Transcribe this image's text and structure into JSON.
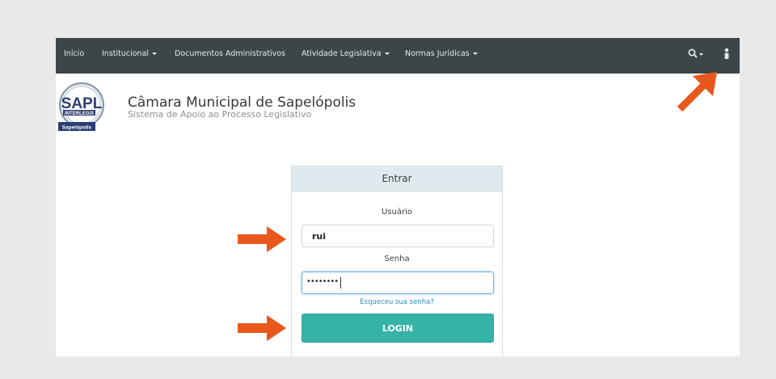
{
  "navbar": {
    "items": [
      {
        "label": "Início",
        "dropdown": false
      },
      {
        "label": "Institucional",
        "dropdown": true
      },
      {
        "label": "Documentos Administrativos",
        "dropdown": false
      },
      {
        "label": "Atividade Legislativa",
        "dropdown": true
      },
      {
        "label": "Normas Jurídicas",
        "dropdown": true
      }
    ],
    "icons": [
      "search-icon",
      "user-icon"
    ]
  },
  "logo": {
    "text": "SAPL",
    "subtext": "INTERLEGIS",
    "badge": "Sapelópolis"
  },
  "brand": {
    "title": "Câmara Municipal de Sapelópolis",
    "subtitle": "Sistema de Apoio ao Processo Legislativo"
  },
  "login": {
    "heading": "Entrar",
    "username_label": "Usuário",
    "username_value": "rui",
    "password_label": "Senha",
    "password_mask": "••••••••",
    "forgot_link": "Esqueceu sua senha?",
    "button_label": "LOGIN"
  },
  "colors": {
    "navbar": "#3c4548",
    "button": "#36b3a7",
    "panel_heading": "#dfeaee",
    "annotation_arrow": "#e8581c",
    "link": "#2a8fbd"
  }
}
